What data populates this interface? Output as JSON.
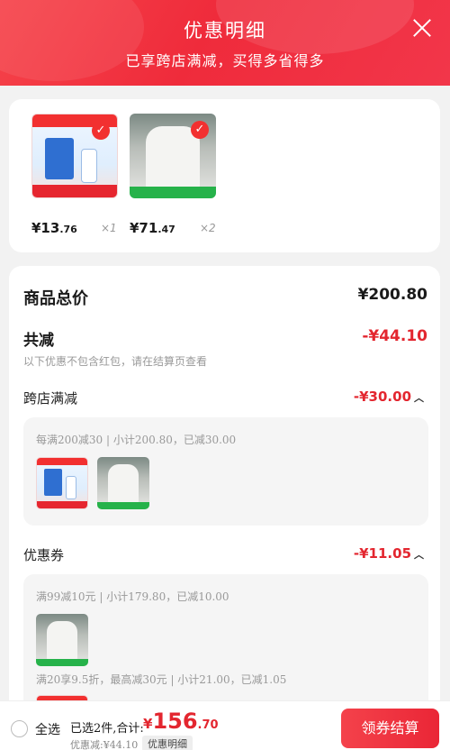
{
  "header": {
    "title": "优惠明细",
    "subtitle": "已享跨店满减，买得多省得多"
  },
  "products": [
    {
      "price_int": "¥13",
      "price_dec": ".76",
      "qty": "×1"
    },
    {
      "price_int": "¥71",
      "price_dec": ".47",
      "qty": "×2"
    }
  ],
  "summary": {
    "total_label": "商品总价",
    "total_value": "¥200.80",
    "reduce_label": "共减",
    "reduce_value": "-¥44.10",
    "reduce_note": "以下优惠不包含红包，请在结算页查看",
    "sections": [
      {
        "label": "跨店满减",
        "value": "-¥30.00",
        "lines": [
          "每满200减30 | 小计200.80，已减30.00"
        ]
      },
      {
        "label": "优惠券",
        "value": "-¥11.05",
        "lines": [
          "满99减10元 | 小计179.80，已减10.00",
          "满20享9.5折，最高减30元 | 小计21.00，已减1.05"
        ]
      }
    ]
  },
  "bottom": {
    "select_all": "全选",
    "selected_text": "已选2件,合计:",
    "price_yen": "¥",
    "price_int": "156",
    "price_dec": ".70",
    "discount_text": "优惠减:¥44.10",
    "detail_link": "优惠明细",
    "checkout": "领券结算"
  },
  "colors": {
    "accent": "#e3262f",
    "header_red": "#f23b45"
  }
}
